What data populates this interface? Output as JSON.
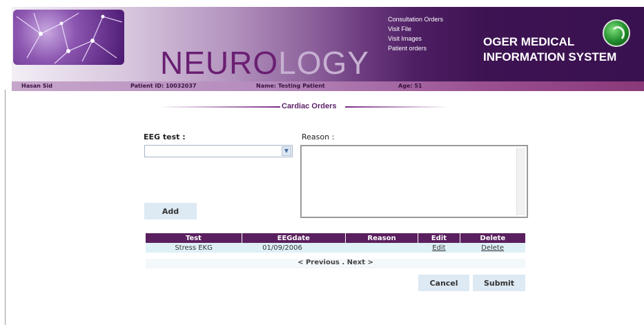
{
  "header": {
    "title_dark": "NEURO",
    "title_light": "LOGY",
    "menu": [
      "Consultation Orders",
      "Visit File",
      "Visit Images",
      "Patient orders"
    ],
    "brand_line1": "OGER MEDICAL",
    "brand_line2": "INFORMATION SYSTEM"
  },
  "info_bar": {
    "user": "Hasan Sid",
    "patient_id": "Patient ID: 10032037",
    "name": "Name: Testing Patient",
    "age": "Age: 51"
  },
  "section": {
    "title": "Cardiac Orders"
  },
  "form": {
    "eeg_label": "EEG test :",
    "eeg_value": "",
    "reason_label": "Reason :",
    "reason_value": "",
    "add_label": "Add"
  },
  "table": {
    "headers": [
      "Test",
      "EEGdate",
      "Reason",
      "Edit",
      "Delete"
    ],
    "rows": [
      {
        "test": "Stress EKG",
        "date": "01/09/2006",
        "reason": "",
        "edit": "Edit",
        "delete": "Delete"
      }
    ]
  },
  "pager": {
    "prev": "< Previous",
    "sep": " . ",
    "next": "Next >"
  },
  "actions": {
    "cancel": "Cancel",
    "submit": "Submit"
  },
  "colors": {
    "header_purple": "#3d1352",
    "table_header": "#5a1f5e",
    "button_bg": "#dde9f3"
  }
}
